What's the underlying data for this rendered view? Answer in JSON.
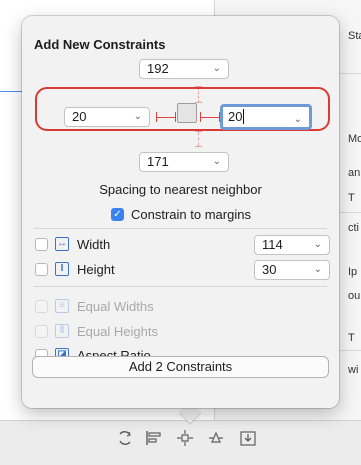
{
  "popover": {
    "title": "Add New Constraints",
    "top": "192",
    "left": "20",
    "right": "20",
    "bottom": "171",
    "spacing_label": "Spacing to nearest neighbor",
    "constrain_margins_label": "Constrain to margins",
    "width_label": "Width",
    "width_value": "114",
    "height_label": "Height",
    "height_value": "30",
    "equal_widths_label": "Equal Widths",
    "equal_heights_label": "Equal Heights",
    "aspect_ratio_label": "Aspect Ratio",
    "add_button_label": "Add 2 Constraints"
  },
  "background": {
    "fragments": [
      "Sta",
      "Mo",
      "an",
      "T",
      "cti",
      "Ip",
      "ou",
      "T",
      "wi"
    ]
  },
  "bottom_bar": {
    "icons": [
      "update-frames-icon",
      "align-icon",
      "add-constraints-icon",
      "resolve-issues-icon",
      "embed-in-icon"
    ]
  }
}
